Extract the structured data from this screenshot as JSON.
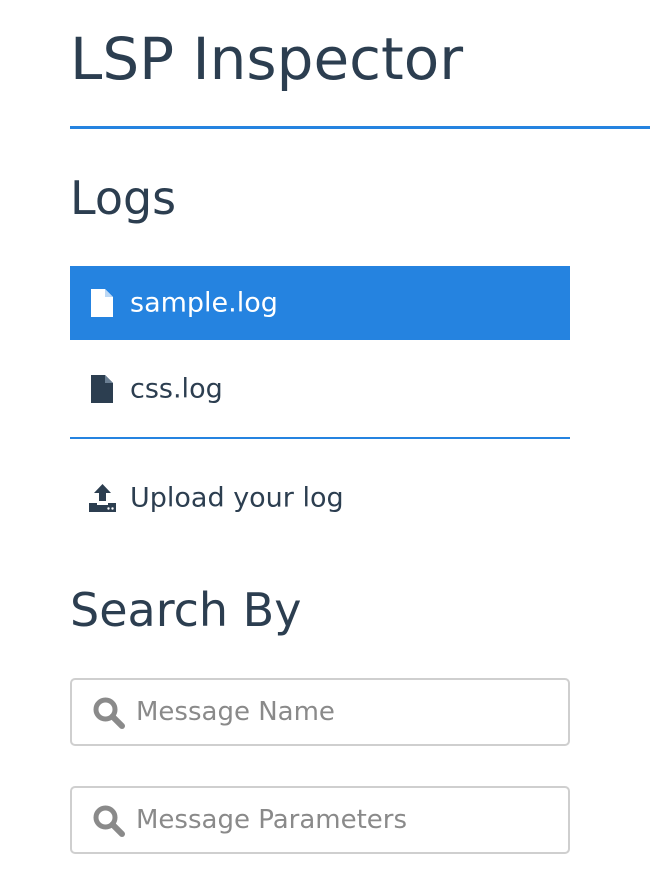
{
  "app": {
    "title": "LSP Inspector"
  },
  "logs": {
    "heading": "Logs",
    "items": [
      {
        "label": "sample.log",
        "icon": "file-icon",
        "selected": true
      },
      {
        "label": "css.log",
        "icon": "file-icon",
        "selected": false
      }
    ],
    "upload": {
      "label": "Upload your log",
      "icon": "upload-icon"
    }
  },
  "search": {
    "heading": "Search By",
    "fields": [
      {
        "placeholder": "Message Name",
        "value": "",
        "icon": "search-icon"
      },
      {
        "placeholder": "Message Parameters",
        "value": "",
        "icon": "search-icon"
      }
    ]
  },
  "colors": {
    "accent": "#2583e0",
    "text": "#2c3e50",
    "placeholder": "#8a8a8a",
    "input_border": "#cfcfcf"
  }
}
